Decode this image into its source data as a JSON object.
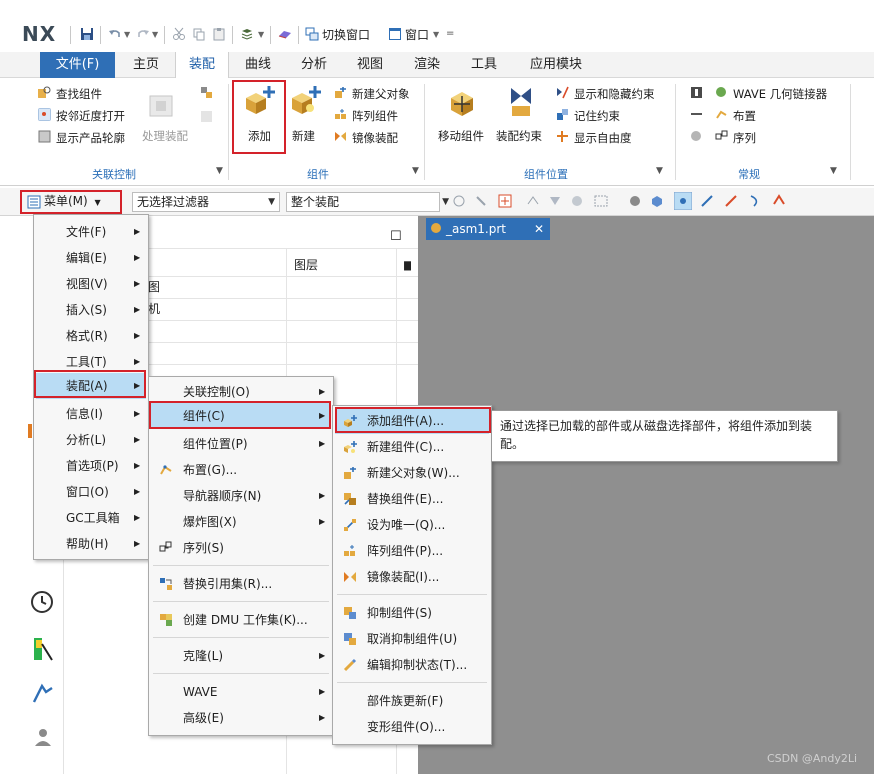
{
  "app": {
    "logo": "NX",
    "quick_access": {
      "switch_window": "切换窗口",
      "window": "窗口"
    }
  },
  "tabs": [
    "文件(F)",
    "主页",
    "装配",
    "曲线",
    "分析",
    "视图",
    "渲染",
    "工具",
    "应用模块"
  ],
  "ribbon": {
    "assoc_group": {
      "label": "关联控制",
      "find_component": "查找组件",
      "open_by_proximity": "按邻近度打开",
      "show_product_outline": "显示产品轮廓",
      "process_assembly": "处理装配"
    },
    "component_group": {
      "label": "组件",
      "add": "添加",
      "new": "新建",
      "new_parent": "新建父对象",
      "array_component": "阵列组件",
      "mirror_assembly": "镜像装配"
    },
    "position_group": {
      "label": "组件位置",
      "move_component": "移动组件",
      "assembly_constraint": "装配约束",
      "show_hide_constraint": "显示和隐藏约束",
      "remember_constraint": "记住约束",
      "show_dof": "显示自由度"
    },
    "general_group": {
      "label": "常规",
      "wave_linker": "WAVE 几何链接器",
      "layout": "布置",
      "sequence": "序列"
    }
  },
  "toolbar": {
    "menu_button": "菜单(M)",
    "filter": "无选择过滤器",
    "scope": "整个装配"
  },
  "graphics": {
    "doc_tab": "_asm1.prt"
  },
  "nav": {
    "col_layer": "图层",
    "partial_row1": "图",
    "partial_row2": "机"
  },
  "main_menu": [
    {
      "label": "文件(F)"
    },
    {
      "label": "编辑(E)"
    },
    {
      "label": "视图(V)"
    },
    {
      "label": "插入(S)"
    },
    {
      "label": "格式(R)"
    },
    {
      "label": "工具(T)"
    },
    {
      "label": "装配(A)"
    },
    {
      "label": "信息(I)"
    },
    {
      "label": "分析(L)"
    },
    {
      "label": "首选项(P)"
    },
    {
      "label": "窗口(O)"
    },
    {
      "label": "GC工具箱"
    },
    {
      "label": "帮助(H)"
    }
  ],
  "assembly_menu": [
    {
      "label": "关联控制(O)"
    },
    {
      "label": "组件(C)"
    },
    {
      "label": "组件位置(P)"
    },
    {
      "label": "布置(G)..."
    },
    {
      "label": "导航器顺序(N)"
    },
    {
      "label": "爆炸图(X)"
    },
    {
      "label": "序列(S)"
    },
    {
      "label": "替换引用集(R)..."
    },
    {
      "label": "创建 DMU 工作集(K)..."
    },
    {
      "label": "克隆(L)"
    },
    {
      "label": "WAVE"
    },
    {
      "label": "高级(E)"
    }
  ],
  "component_menu": [
    {
      "label": "添加组件(A)..."
    },
    {
      "label": "新建组件(C)..."
    },
    {
      "label": "新建父对象(W)..."
    },
    {
      "label": "替换组件(E)..."
    },
    {
      "label": "设为唯一(Q)..."
    },
    {
      "label": "阵列组件(P)..."
    },
    {
      "label": "镜像装配(I)..."
    },
    {
      "label": "抑制组件(S)"
    },
    {
      "label": "取消抑制组件(U)"
    },
    {
      "label": "编辑抑制状态(T)..."
    },
    {
      "label": "部件族更新(F)"
    },
    {
      "label": "变形组件(O)..."
    }
  ],
  "tooltip": "通过选择已加载的部件或从磁盘选择部件，将组件添加到装配。",
  "watermark": "CSDN @Andy2Li",
  "colors": {
    "accent": "#2f6fb6",
    "highlight": "#b9dcf4",
    "red_box": "#d4222a",
    "graphics_bg": "#8f8f8f"
  }
}
